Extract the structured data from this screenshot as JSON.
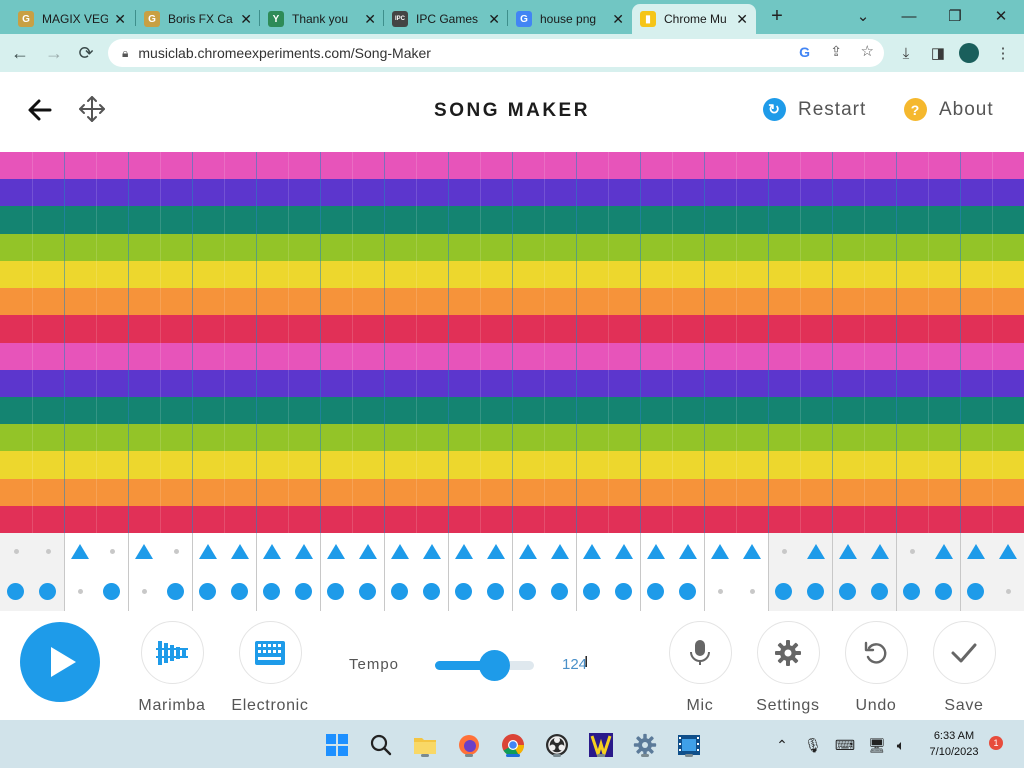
{
  "browser": {
    "tabs": [
      {
        "title": "MAGIX VEG",
        "favicon_text": "G",
        "favicon_color": "#c8a043"
      },
      {
        "title": "Boris FX Ca",
        "favicon_text": "G",
        "favicon_color": "#c8a043"
      },
      {
        "title": "Thank you",
        "favicon_text": "Y",
        "favicon_color": "#2e8b57"
      },
      {
        "title": "IPC Games",
        "favicon_text": "IPC",
        "favicon_color": "#444444"
      },
      {
        "title": "house png",
        "favicon_text": "G",
        "favicon_color": "#4285f4"
      },
      {
        "title": "Chrome Mu",
        "favicon_text": "▮",
        "favicon_color": "#f5c518"
      }
    ],
    "active_tab_index": 5,
    "new_tab_label": "+",
    "url": "musiclab.chromeexperiments.com/Song-Maker",
    "icons": {
      "back": "back-arrow-icon",
      "forward": "forward-arrow-icon",
      "reload": "reload-icon",
      "lock": "lock-icon"
    }
  },
  "app": {
    "title": "SONG MAKER",
    "restart_label": "Restart",
    "about_label": "About",
    "accent_color": "#1e9be9",
    "about_color": "#f5b82e"
  },
  "grid": {
    "columns": 32,
    "row_colors": [
      "#e754ba",
      "#5c36cd",
      "#148471",
      "#93c428",
      "#edd72d",
      "#f6933a",
      "#e13057",
      "#e754ba",
      "#5c36cd",
      "#148471",
      "#93c428",
      "#edd72d",
      "#f6933a",
      "#e13057"
    ]
  },
  "percussion": {
    "top_row": [
      "empty",
      "empty",
      "triangle",
      "empty",
      "triangle",
      "empty",
      "triangle",
      "triangle",
      "triangle",
      "triangle",
      "triangle",
      "triangle",
      "triangle",
      "triangle",
      "triangle",
      "triangle",
      "triangle",
      "triangle",
      "triangle",
      "triangle",
      "triangle",
      "triangle",
      "triangle",
      "triangle",
      "empty",
      "triangle",
      "triangle",
      "triangle",
      "empty",
      "triangle",
      "triangle",
      "triangle"
    ],
    "bottom_row": [
      "dot",
      "dot",
      "empty",
      "dot",
      "empty",
      "dot",
      "dot",
      "dot",
      "dot",
      "dot",
      "dot",
      "dot",
      "dot",
      "dot",
      "dot",
      "dot",
      "dot",
      "dot",
      "dot",
      "dot",
      "dot",
      "dot",
      "empty",
      "empty",
      "dot",
      "dot",
      "dot",
      "dot",
      "dot",
      "dot",
      "dot",
      "empty"
    ],
    "highlighted_column_ranges": [
      [
        2,
        15
      ],
      [
        16,
        23
      ]
    ]
  },
  "controls": {
    "instrument_label": "Marimba",
    "percussion_label": "Electronic",
    "tempo_label": "Tempo",
    "tempo_value": "124",
    "tempo_fraction": 0.6,
    "mic_label": "Mic",
    "settings_label": "Settings",
    "undo_label": "Undo",
    "save_label": "Save"
  },
  "taskbar": {
    "apps": [
      "windows-start-icon",
      "search-icon",
      "file-explorer-icon",
      "firefox-icon",
      "chrome-icon",
      "obs-icon",
      "magix-vegas-icon",
      "settings-gear-icon",
      "video-editor-icon"
    ],
    "time": "6:33 AM",
    "date": "7/10/2023",
    "notification_count": "1"
  }
}
